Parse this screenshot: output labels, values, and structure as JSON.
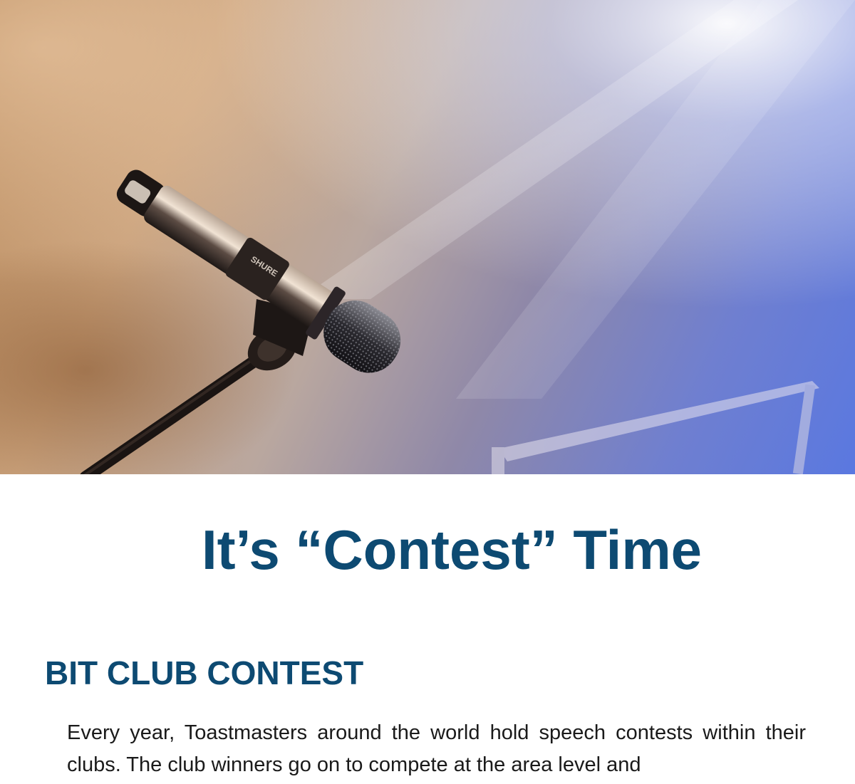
{
  "hero": {
    "image_subject": "microphone-on-stand-under-stage-lights",
    "brand_on_microphone": "SHURE"
  },
  "title": "It’s “Contest” Time",
  "section": {
    "heading": "BIT CLUB CONTEST",
    "body": "Every year, Toastmasters around the world hold speech contests within their clubs. The club winners go on to compete at the area level and"
  },
  "colors": {
    "heading": "#0d4a72",
    "body_text": "#1a1a1a",
    "hero_warm": "#caa27c",
    "hero_cool": "#5a78e0"
  }
}
